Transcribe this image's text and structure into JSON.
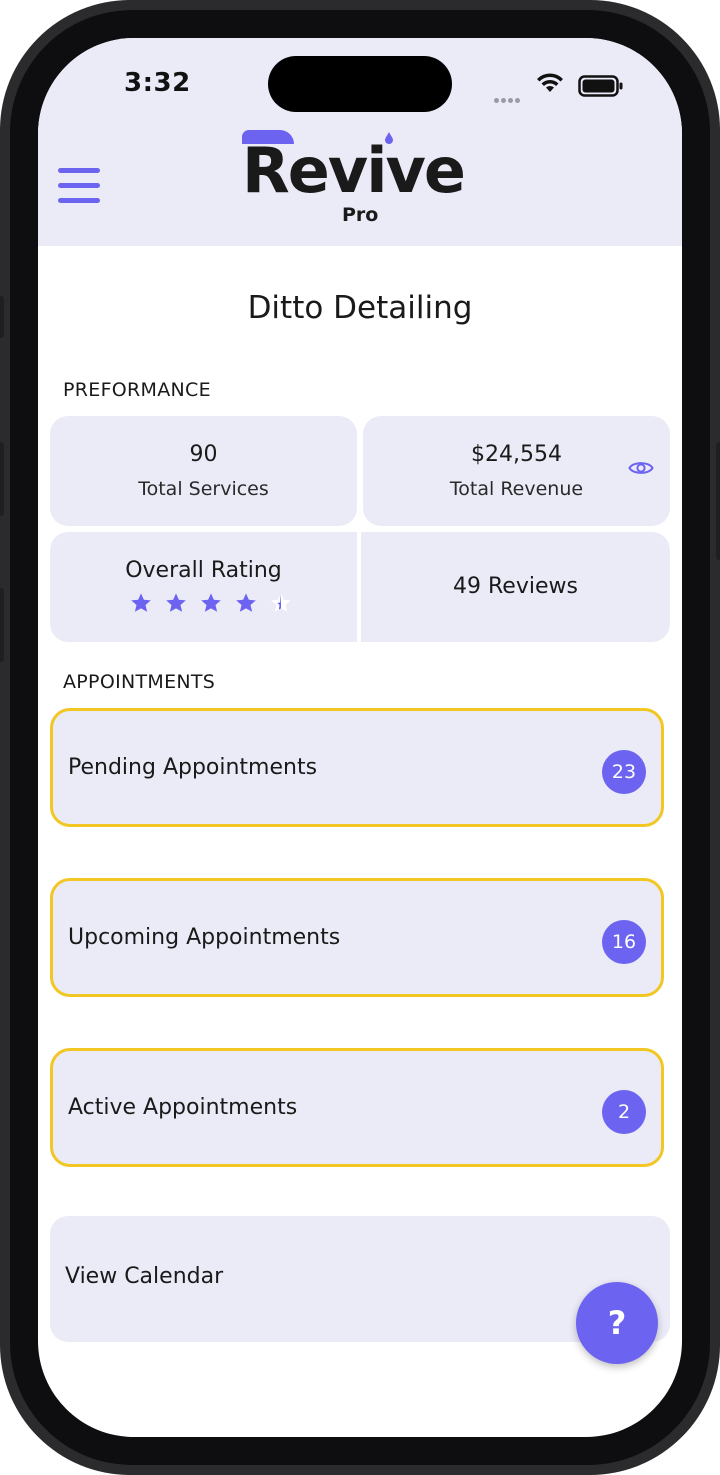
{
  "status_bar": {
    "time": "3:32",
    "wifi_icon": "wifi-icon",
    "battery_icon": "battery-icon"
  },
  "header": {
    "menu_icon": "hamburger-menu-icon",
    "logo_text": "Revive",
    "logo_sub": "Pro"
  },
  "page": {
    "title": "Ditto Detailing"
  },
  "performance": {
    "label": "PREFORMANCE",
    "total_services_value": "90",
    "total_services_label": "Total Services",
    "total_revenue_value": "$24,554",
    "total_revenue_label": "Total Revenue",
    "rating_label": "Overall Rating",
    "rating_stars": 4.5,
    "reviews_label": "49 Reviews"
  },
  "appointments": {
    "label": "APPOINTMENTS",
    "items": [
      {
        "label": "Pending Appointments",
        "count": "23"
      },
      {
        "label": "Upcoming Appointments",
        "count": "16"
      },
      {
        "label": "Active Appointments",
        "count": "2"
      }
    ],
    "calendar_label": "View Calendar"
  },
  "help": {
    "label": "?"
  },
  "colors": {
    "accent": "#6c63f0",
    "card_bg": "#ebebf8",
    "appointment_border": "#f2c623"
  }
}
